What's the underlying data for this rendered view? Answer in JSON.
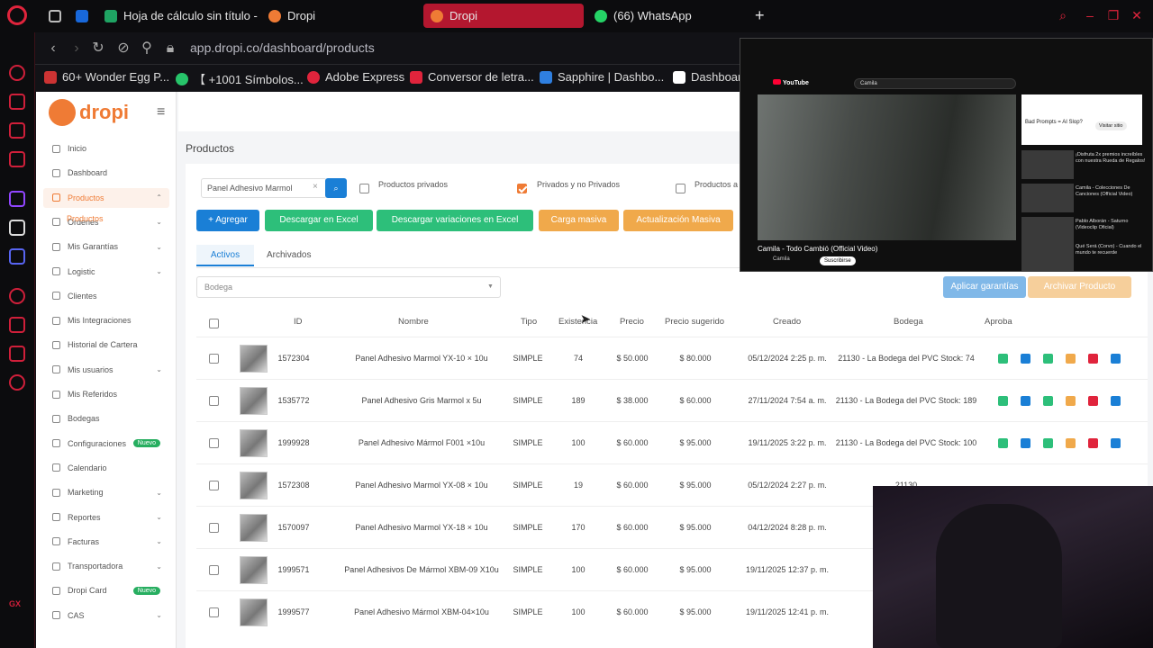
{
  "browser": {
    "tabs": [
      {
        "label": "",
        "icon": "gamepad-icon"
      },
      {
        "label": "",
        "icon": "trello-icon"
      },
      {
        "label": "Hoja de cálculo sin título -",
        "icon": "sheets-icon"
      },
      {
        "label": "Dropi",
        "icon": "dropi-icon"
      },
      {
        "label": "Dropi",
        "icon": "dropi-icon",
        "active": true
      },
      {
        "label": "(66) WhatsApp",
        "icon": "whatsapp-icon"
      }
    ],
    "new_tab": "+",
    "url": "app.dropi.co/dashboard/products",
    "bookmarks": [
      "60+ Wonder Egg P...",
      "【 +1001 Símbolos...",
      "Adobe Express",
      "Conversor de letra...",
      "Sapphire | Dashbo...",
      "Dashboard"
    ],
    "colors": {
      "accent": "#e0243c",
      "active_tab": "#b4172f"
    }
  },
  "dropi": {
    "logo": "dropi",
    "colors": {
      "brand": "#ef7b35",
      "primary": "#1a7fd6",
      "success": "#27ae60",
      "warning": "#f0a94b"
    },
    "menu": [
      {
        "label": "Inicio"
      },
      {
        "label": "Dashboard"
      },
      {
        "label": "Productos",
        "expanded": true,
        "selected": true
      },
      {
        "label": "Ordenes",
        "chevron": true
      },
      {
        "label": "Mis Garantías",
        "chevron": true
      },
      {
        "label": "Logistic",
        "chevron": true
      },
      {
        "label": "Clientes"
      },
      {
        "label": "Mis Integraciones"
      },
      {
        "label": "Historial de Cartera"
      },
      {
        "label": "Mis usuarios",
        "chevron": true
      },
      {
        "label": "Mis Referidos"
      },
      {
        "label": "Bodegas"
      },
      {
        "label": "Configuraciones",
        "badge": "Nuevo"
      },
      {
        "label": "Calendario"
      },
      {
        "label": "Marketing",
        "chevron": true
      },
      {
        "label": "Reportes",
        "chevron": true
      },
      {
        "label": "Facturas",
        "chevron": true
      },
      {
        "label": "Transportadora",
        "chevron": true
      },
      {
        "label": "Dropi Card",
        "badge": "Nuevo"
      },
      {
        "label": "CAS",
        "chevron": true
      }
    ],
    "submenu": "Productos",
    "page_title": "Productos",
    "search": {
      "value": "Panel Adhesivo Marmol",
      "clear": "×"
    },
    "filters": {
      "privados": "Productos privados",
      "privados_y_no": "Privados y no Privados",
      "productos_a": "Productos a"
    },
    "buttons": {
      "agregar": "+ Agregar",
      "excel": "Descargar en Excel",
      "variaciones": "Descargar variaciones en Excel",
      "carga": "Carga masiva",
      "actualizacion": "Actualización Masiva",
      "aplicar_garantias": "Aplicar garantías",
      "archivar": "Archivar Producto"
    },
    "tabs": {
      "activos": "Activos",
      "archivados": "Archivados"
    },
    "bodega_placeholder": "Bodega",
    "table": {
      "headers": {
        "id": "ID",
        "nombre": "Nombre",
        "tipo": "Tipo",
        "existencia": "Existencia",
        "precio": "Precio",
        "sugerido": "Precio sugerido",
        "creado": "Creado",
        "bodega": "Bodega",
        "aprobado": "Aproba"
      },
      "rows": [
        {
          "id": "1572304",
          "nombre": "Panel Adhesivo Marmol YX-10 × 10u",
          "tipo": "SIMPLE",
          "existencia": "74",
          "precio": "$ 50.000",
          "sugerido": "$ 80.000",
          "creado": "05/12/2024 2:25 p. m.",
          "bodega": "21130 - La Bodega del PVC Stock: 74"
        },
        {
          "id": "1535772",
          "nombre": "Panel Adhesivo Gris Marmol x 5u",
          "tipo": "SIMPLE",
          "existencia": "189",
          "precio": "$ 38.000",
          "sugerido": "$ 60.000",
          "creado": "27/11/2024 7:54 a. m.",
          "bodega": "21130 - La Bodega del PVC Stock: 189"
        },
        {
          "id": "1999928",
          "nombre": "Panel Adhesivo Mármol F001 ×10u",
          "tipo": "SIMPLE",
          "existencia": "100",
          "precio": "$ 60.000",
          "sugerido": "$ 95.000",
          "creado": "19/11/2025 3:22 p. m.",
          "bodega": "21130 - La Bodega del PVC Stock: 100"
        },
        {
          "id": "1572308",
          "nombre": "Panel Adhesivo Marmol YX-08 × 10u",
          "tipo": "SIMPLE",
          "existencia": "19",
          "precio": "$ 60.000",
          "sugerido": "$ 95.000",
          "creado": "05/12/2024 2:27 p. m.",
          "bodega": "21130"
        },
        {
          "id": "1570097",
          "nombre": "Panel Adhesivo Marmol YX-18 × 10u",
          "tipo": "SIMPLE",
          "existencia": "170",
          "precio": "$ 60.000",
          "sugerido": "$ 95.000",
          "creado": "04/12/2024 8:28 p. m.",
          "bodega": ""
        },
        {
          "id": "1999571",
          "nombre": "Panel Adhesivos De Mármol XBM-09 X10u",
          "tipo": "SIMPLE",
          "existencia": "100",
          "precio": "$ 60.000",
          "sugerido": "$ 95.000",
          "creado": "19/11/2025 12:37 p. m.",
          "bodega": ""
        },
        {
          "id": "1999577",
          "nombre": "Panel Adhesivo Mármol XBM-04×10u",
          "tipo": "SIMPLE",
          "existencia": "100",
          "precio": "$ 60.000",
          "sugerido": "$ 95.000",
          "creado": "19/11/2025 12:41 p. m.",
          "bodega": ""
        }
      ]
    }
  },
  "youtube_overlay": {
    "logo": "YouTube",
    "search": "Camila",
    "video_title": "Camila - Todo Cambió (Official Video)",
    "channel": "Camila",
    "subscribe": "Suscribirse",
    "ad": {
      "title": "Bad Prompts = AI Slop?",
      "button": "Visitar sitio"
    },
    "suggestions": [
      "¡Disfruta 2x premios increíbles con nuestra Rueda de Regalos!",
      "Camila - Colecciones De Canciones (Official Video)",
      "Pablo Alborán - Saturno (Videoclip Oficial)",
      "Qué Será (Corvo) - Cuando el mundo te recuerde"
    ]
  }
}
